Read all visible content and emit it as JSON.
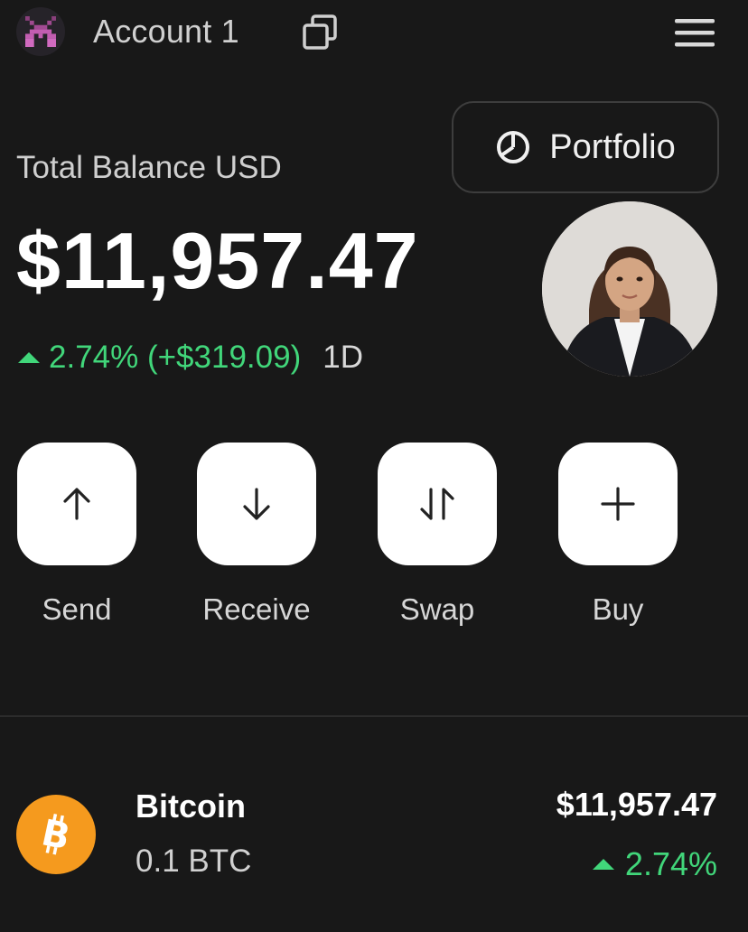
{
  "header": {
    "account_name": "Account 1",
    "icons": {
      "avatar": "pixel-logo-icon",
      "copy": "copy-icon",
      "menu": "hamburger-menu-icon"
    }
  },
  "portfolio_button": {
    "label": "Portfolio",
    "icon": "pie-chart-icon"
  },
  "balance": {
    "label": "Total Balance USD",
    "amount": "$11,957.47",
    "change": "2.74% (+$319.09)",
    "period": "1D"
  },
  "actions": [
    {
      "label": "Send",
      "icon": "arrow-up-icon"
    },
    {
      "label": "Receive",
      "icon": "arrow-down-icon"
    },
    {
      "label": "Swap",
      "icon": "swap-arrows-icon"
    },
    {
      "label": "Buy",
      "icon": "plus-icon"
    }
  ],
  "assets": [
    {
      "name": "Bitcoin",
      "amount": "0.1 BTC",
      "value": "$11,957.47",
      "change": "2.74%",
      "icon": "bitcoin-icon",
      "icon_color": "#f59a1e"
    }
  ],
  "colors": {
    "background": "#181818",
    "positive": "#41d67a",
    "button": "#ffffff"
  }
}
